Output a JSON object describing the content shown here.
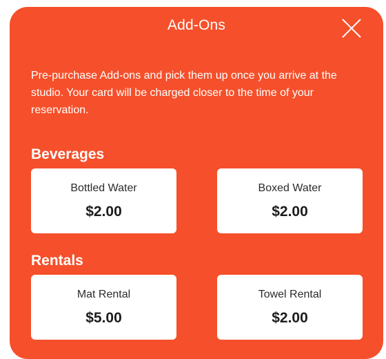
{
  "modal": {
    "title": "Add-Ons",
    "close_icon": "close-icon",
    "description": "Pre-purchase Add-ons and pick them up once you arrive at the studio. Your card will be charged closer to the time of your reservation.",
    "accent_color": "#f5502b"
  },
  "sections": [
    {
      "title": "Beverages",
      "items": [
        {
          "name": "Bottled Water",
          "price": "$2.00"
        },
        {
          "name": "Boxed Water",
          "price": "$2.00"
        }
      ]
    },
    {
      "title": "Rentals",
      "items": [
        {
          "name": "Mat Rental",
          "price": "$5.00"
        },
        {
          "name": "Towel Rental",
          "price": "$2.00"
        }
      ]
    }
  ]
}
